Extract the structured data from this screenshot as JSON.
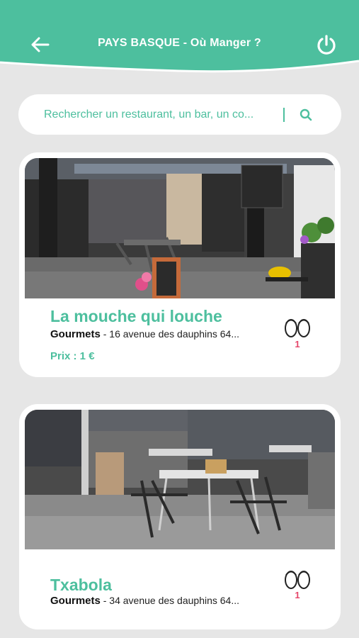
{
  "header": {
    "title": "PAYS BASQUE - Où Manger ?",
    "back_icon": "arrow-left-icon",
    "power_icon": "power-icon",
    "color": "#4dbf9e"
  },
  "search": {
    "placeholder": "Rechercher un restaurant, un bar, un co...",
    "icon": "search-icon"
  },
  "restaurants": [
    {
      "name": "La mouche qui louche",
      "category": "Gourmets",
      "address": " - 16 avenue des dauphins 64...",
      "price": "Prix : 1 €",
      "views": "1",
      "photo": "terrace-photo-1"
    },
    {
      "name": "Txabola",
      "category": "Gourmets",
      "address": " - 34 avenue des dauphins 64...",
      "views": "1",
      "photo": "terrace-photo-2"
    }
  ],
  "colors": {
    "accent": "#4dbf9e",
    "count": "#e5476a",
    "background": "#e6e6e6"
  }
}
